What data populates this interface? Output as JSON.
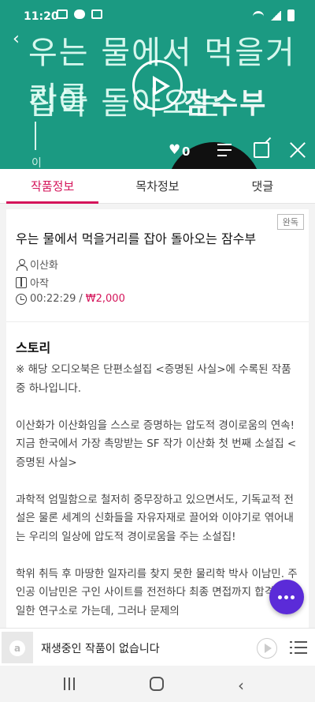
{
  "status_bar": {
    "time": "11:20"
  },
  "cover": {
    "line1": "우는 물에서 먹을거리를",
    "line2": "잡아 돌아오는",
    "bold": "잠수부",
    "small": "이",
    "likes": "0",
    "colors": {
      "background": "#1b9a82"
    }
  },
  "tabs": [
    {
      "label": "작품정보",
      "active": true
    },
    {
      "label": "목차정보",
      "active": false
    },
    {
      "label": "댓글",
      "active": false
    }
  ],
  "info": {
    "badge": "완독",
    "title": "우는 물에서 먹을거리를 잡아 돌아오는 잠수부",
    "author": "이산화",
    "publisher": "아작",
    "duration": "00:22:29",
    "separator": "/",
    "price": "₩2,000"
  },
  "story": {
    "heading": "스토리",
    "body": "※ 해당 오디오북은 단편소설집 <증명된 사실>에 수록된 작품 중 하나입니다.\n\n이산화가 이산화임을 스스로 증명하는 압도적 경이로움의 연속!\n지금 한국에서 가장 촉망받는 SF 작가 이산화 첫 번째 소설집 <증명된 사실>\n\n과학적 엄밀함으로 철저히 중무장하고 있으면서도, 기독교적 전설은 물론 세계의 신화들을 자유자재로 끌어와 이야기로 엮어내는 우리의 일상에 압도적 경이로움을 주는 소설집!\n\n학위 취득 후 마땅한 일자리를 찾지 못한 물리학 박사 이남민. 주인공 이남민은 구인 사이트를 전전하다 최종 면접까지 합격한 유일한 연구소로 가는데, 그러나 문제의"
  },
  "player": {
    "text": "재생중인 작품이 없습니다",
    "logo": "a"
  },
  "accent_color": "#d4145a",
  "fab_color": "#5b2bd8"
}
